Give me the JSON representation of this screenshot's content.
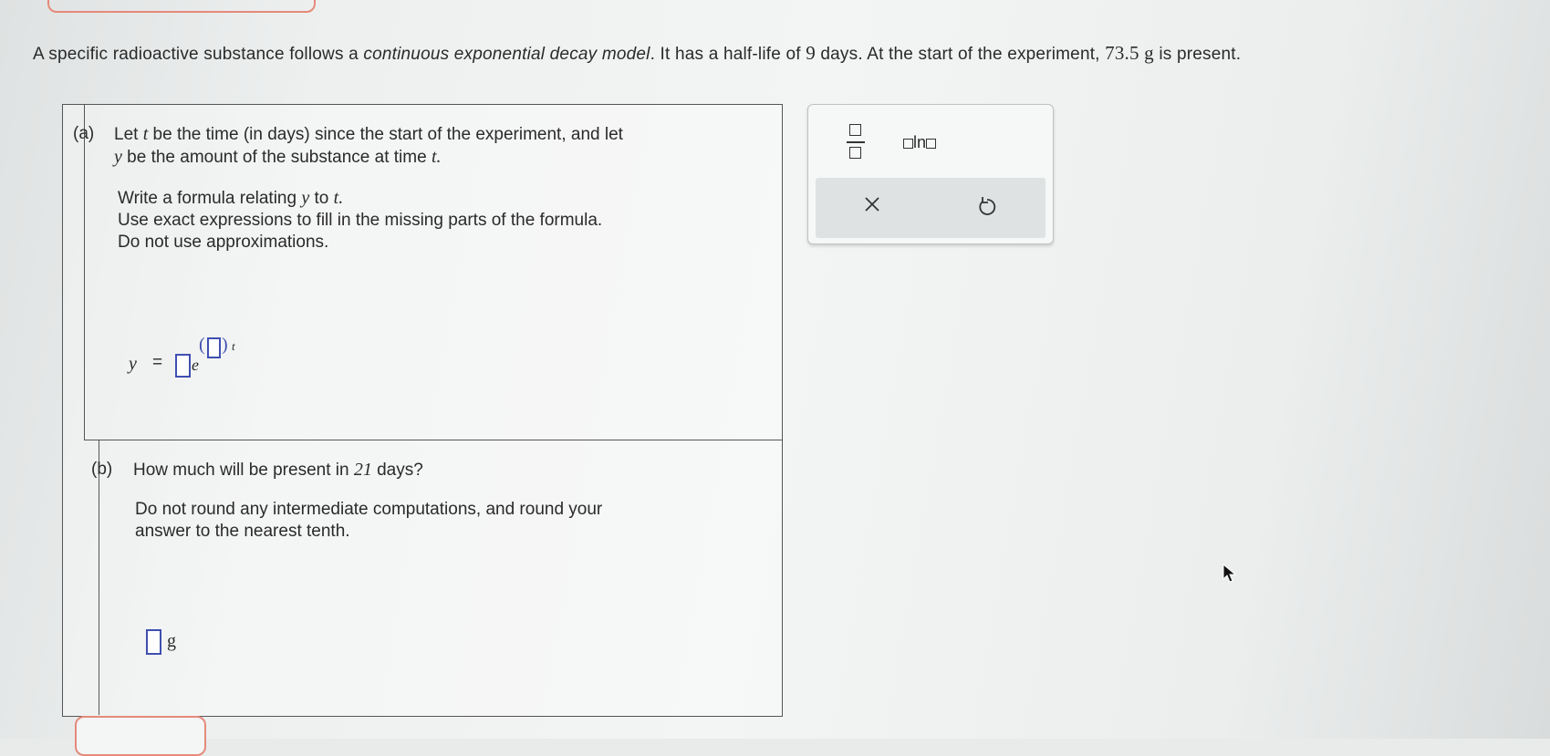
{
  "problem": {
    "part1": "A specific radioactive substance follows a ",
    "italic": "continuous exponential decay model",
    "part2": ". It has a half-life of ",
    "half_life": "9",
    "part3": " days. At the start of the experiment, ",
    "amount": "73.5 g",
    "part4": " is present."
  },
  "part_a": {
    "label": "(a)",
    "line1_pre": "Let ",
    "var_t": "t",
    "line1_post": " be the time (in days) since the start of the experiment, and let",
    "var_y": "y",
    "line2_post": " be the amount of the substance at time ",
    "var_t2": "t.",
    "line3_pre": "Write a formula relating ",
    "line3_y": "y",
    "line3_mid": " to ",
    "line3_t": "t.",
    "line4": "Use exact expressions to fill in the missing parts of the formula.",
    "line5": "Do not use approximations.",
    "formula_lhs": "y",
    "formula_eq": "=",
    "formula_e": "e",
    "formula_t": "t"
  },
  "part_b": {
    "label": "(b)",
    "question_pre": "How much will be present in ",
    "days": "21",
    "question_post": " days?",
    "instr1": "Do not round any intermediate computations, and round your",
    "instr2": "answer to the nearest tenth.",
    "unit": "g"
  },
  "toolbox": {
    "fraction_icon": "fraction-icon",
    "ln_label": "ln",
    "clear_icon": "close-icon",
    "undo_icon": "undo-icon"
  }
}
